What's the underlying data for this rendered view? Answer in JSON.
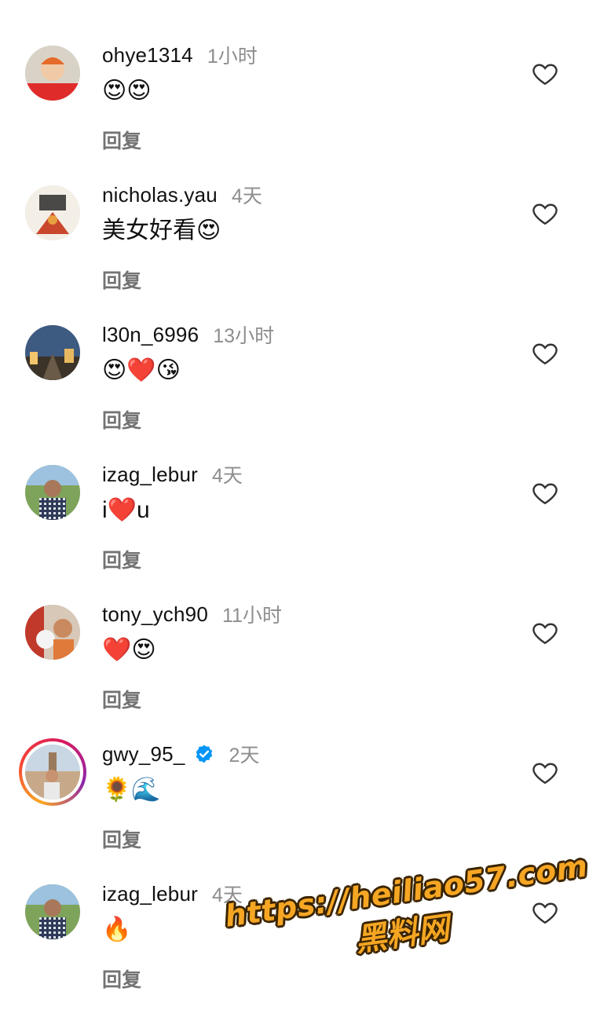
{
  "comments": [
    {
      "user": "ohye1314",
      "time": "1小时",
      "text": "😍😍",
      "reply": "回复",
      "verified": false
    },
    {
      "user": "nicholas.yau",
      "time": "4天",
      "text": "美女好看😍",
      "reply": "回复",
      "verified": false
    },
    {
      "user": "l30n_6996",
      "time": "13小时",
      "text": "😍❤️😘",
      "reply": "回复",
      "verified": false
    },
    {
      "user": "izag_lebur",
      "time": "4天",
      "text": "i❤️u",
      "reply": "回复",
      "verified": false
    },
    {
      "user": "tony_ych90",
      "time": "11小时",
      "text": "❤️😍",
      "reply": "回复",
      "verified": false
    },
    {
      "user": "gwy_95_",
      "time": "2天",
      "text": "🌻🌊",
      "reply": "回复",
      "verified": true
    },
    {
      "user": "izag_lebur",
      "time": "4天",
      "text": "🔥",
      "reply": "回复",
      "verified": false
    }
  ],
  "watermark": {
    "url": "https://heiliao57.com",
    "name": "黑料网"
  },
  "colors": {
    "verified_blue": "#0095f6",
    "muted": "#8e8e8e",
    "story_ring": "#d81b60"
  },
  "icons": {
    "like": "heart-outline-icon",
    "verified": "verified-badge-icon"
  }
}
